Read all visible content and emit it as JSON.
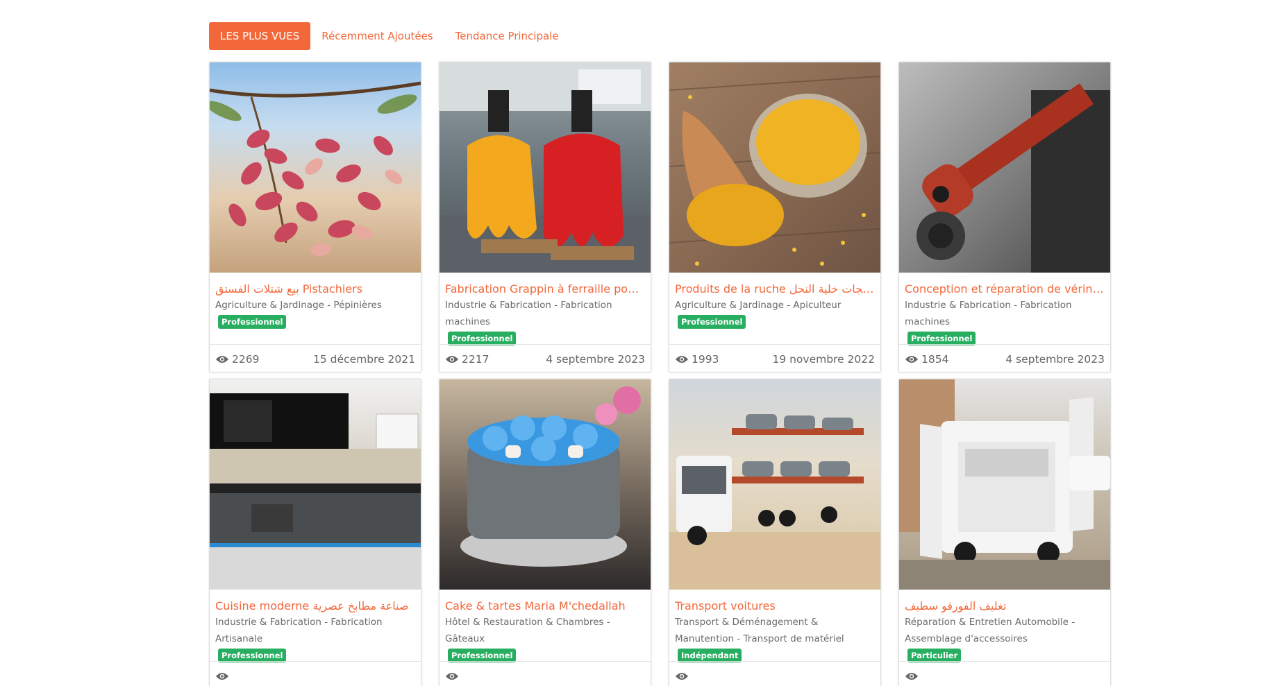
{
  "tabs": [
    {
      "label": "LES PLUS VUES",
      "active": true
    },
    {
      "label": "Récemment Ajoutées",
      "active": false
    },
    {
      "label": "Tendance Principale",
      "active": false
    }
  ],
  "colors": {
    "accent": "#f2683b",
    "badge": "#27ae60"
  },
  "cards": [
    {
      "title": "بيع شتلات الفستق Pistachiers",
      "category": "Agriculture & Jardinage - Pépinières",
      "badge": "Professionnel",
      "views": "2269",
      "date": "15 décembre 2021",
      "image": "pistachios"
    },
    {
      "title": "Fabrication Grappin à ferraille pour grue",
      "category": "Industrie & Fabrication - Fabrication machines",
      "badge": "Professionnel",
      "views": "2217",
      "date": "4 septembre 2023",
      "image": "grapple"
    },
    {
      "title": "Produits de la ruche منتجات خلية النحل",
      "category": "Agriculture & Jardinage - Apiculteur",
      "badge": "Professionnel",
      "views": "1993",
      "date": "19 novembre 2022",
      "image": "pollen"
    },
    {
      "title": "Conception et réparation de vérins hydrauliques",
      "category": "Industrie & Fabrication - Fabrication machines",
      "badge": "Professionnel",
      "views": "1854",
      "date": "4 septembre 2023",
      "image": "cylinder"
    },
    {
      "title": "Cuisine moderne صناعة مطابخ عصرية",
      "category": "Industrie & Fabrication - Fabrication Artisanale",
      "badge": "Professionnel",
      "views": "",
      "date": "",
      "image": "kitchen"
    },
    {
      "title": "Cake & tartes Maria M'chedallah",
      "category": "Hôtel & Restauration & Chambres - Gâteaux",
      "badge": "Professionnel",
      "views": "",
      "date": "",
      "image": "cake"
    },
    {
      "title": "Transport voitures",
      "category": "Transport & Déménagement & Manutention - Transport de matériel",
      "badge": "Indépendant",
      "views": "",
      "date": "",
      "image": "truck"
    },
    {
      "title": "تغليف الفورقو سطيف",
      "category": "Réparation & Entretien Automobile - Assemblage d'accessoires",
      "badge": "Particulier",
      "views": "",
      "date": "",
      "image": "van"
    }
  ]
}
